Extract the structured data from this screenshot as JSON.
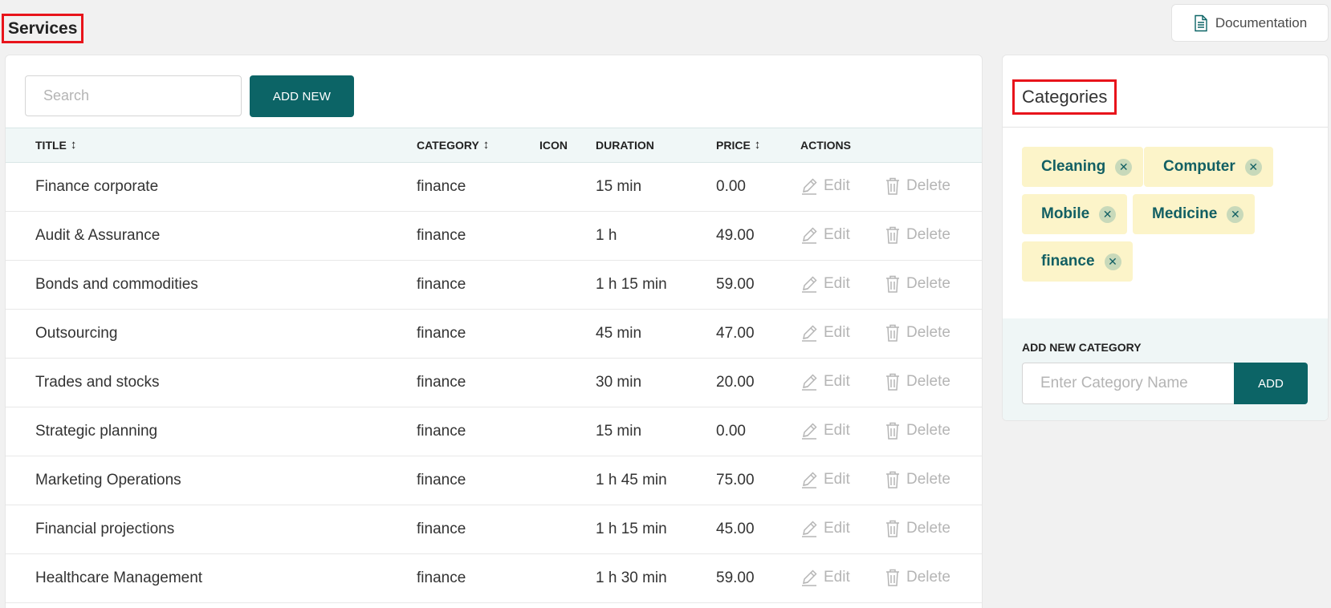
{
  "header": {
    "title": "Services",
    "doc_label": "Documentation"
  },
  "toolbar": {
    "search_placeholder": "Search",
    "add_new_label": "ADD NEW"
  },
  "table": {
    "columns": {
      "title": "TITLE",
      "category": "CATEGORY",
      "icon": "ICON",
      "duration": "DURATION",
      "price": "PRICE",
      "actions": "ACTIONS"
    },
    "edit_label": "Edit",
    "delete_label": "Delete",
    "rows": [
      {
        "title": "Finance corporate",
        "category": "finance",
        "duration": "15 min",
        "price": "0.00"
      },
      {
        "title": "Audit & Assurance",
        "category": "finance",
        "duration": "1 h",
        "price": "49.00"
      },
      {
        "title": "Bonds and commodities",
        "category": "finance",
        "duration": "1 h 15 min",
        "price": "59.00"
      },
      {
        "title": "Outsourcing",
        "category": "finance",
        "duration": "45 min",
        "price": "47.00"
      },
      {
        "title": "Trades and stocks",
        "category": "finance",
        "duration": "30 min",
        "price": "20.00"
      },
      {
        "title": "Strategic planning",
        "category": "finance",
        "duration": "15 min",
        "price": "0.00"
      },
      {
        "title": "Marketing Operations",
        "category": "finance",
        "duration": "1 h 45 min",
        "price": "75.00"
      },
      {
        "title": "Financial projections",
        "category": "finance",
        "duration": "1 h 15 min",
        "price": "45.00"
      },
      {
        "title": "Healthcare Management",
        "category": "finance",
        "duration": "1 h 30 min",
        "price": "59.00"
      }
    ]
  },
  "categories": {
    "title": "Categories",
    "chips": [
      "Cleaning",
      "Computer",
      "Mobile",
      "Medicine",
      "finance"
    ],
    "add_label": "ADD NEW CATEGORY",
    "input_placeholder": "Enter Category Name",
    "add_button": "ADD"
  },
  "colors": {
    "primary": "#0c6466",
    "chip_bg": "#fcf4c9",
    "highlight_border": "#e8141b"
  }
}
